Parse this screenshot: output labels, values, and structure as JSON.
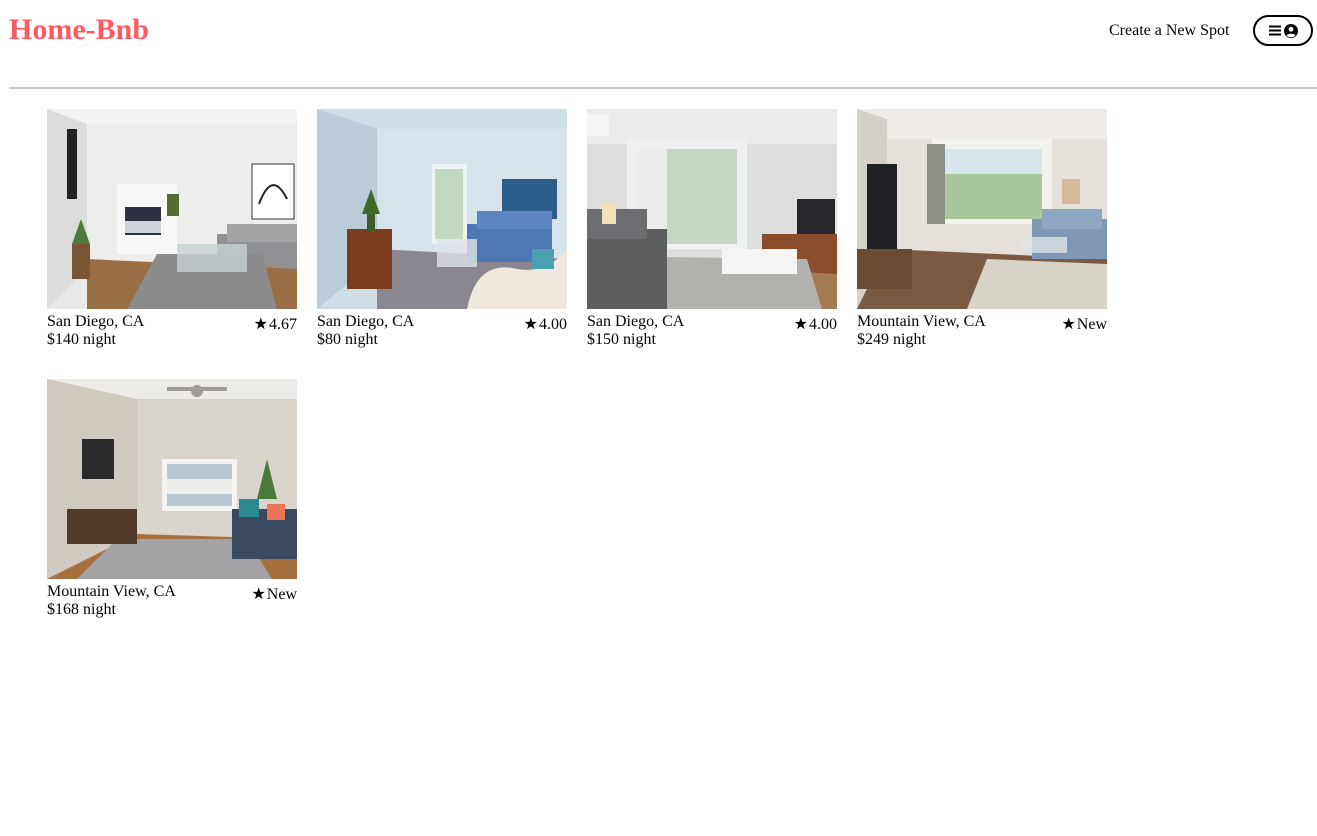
{
  "header": {
    "logo": "Home-Bnb",
    "create_link": "Create a New Spot"
  },
  "colors": {
    "brand": "#ff5a5f",
    "divider": "#c8c8c8"
  },
  "icons": {
    "menu": "hamburger-icon",
    "user": "user-circle-icon",
    "star": "star-icon"
  },
  "spots": [
    {
      "location": "San Diego, CA",
      "price": "$140",
      "price_unit": "night",
      "rating": "4.67",
      "image": "bedroom-living-studio"
    },
    {
      "location": "San Diego, CA",
      "price": "$80",
      "price_unit": "night",
      "rating": "4.00",
      "image": "blue-sofa-living-room"
    },
    {
      "location": "San Diego, CA",
      "price": "$150",
      "price_unit": "night",
      "rating": "4.00",
      "image": "balcony-living-room"
    },
    {
      "location": "Mountain View, CA",
      "price": "$249",
      "price_unit": "night",
      "rating": "New",
      "image": "bright-living-room"
    },
    {
      "location": "Mountain View, CA",
      "price": "$168",
      "price_unit": "night",
      "rating": "New",
      "image": "ceiling-fan-living-room"
    }
  ]
}
